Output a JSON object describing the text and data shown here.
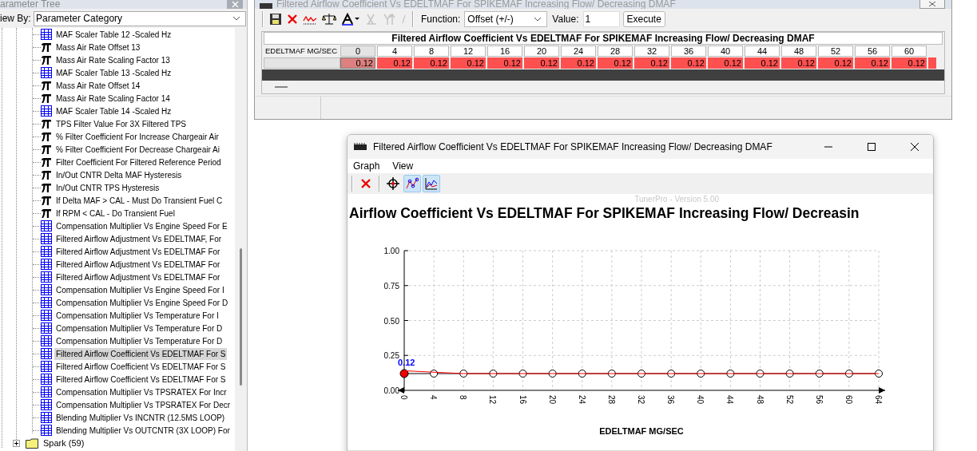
{
  "parameter_tree": {
    "title": "arameter Tree",
    "view_by_label": "iew By:",
    "view_by_value": "Parameter Category",
    "items": [
      {
        "label": "MAF Scaler Table 12 -Scaled Hz",
        "kind": "table",
        "selected": false
      },
      {
        "label": "Mass Air Rate Offset 13",
        "kind": "constant",
        "selected": false
      },
      {
        "label": "Mass Air Rate Scaling Factor 13",
        "kind": "constant",
        "selected": false
      },
      {
        "label": "MAF Scaler Table 13 -Scaled Hz",
        "kind": "table",
        "selected": false
      },
      {
        "label": "Mass Air Rate Offset 14",
        "kind": "constant",
        "selected": false
      },
      {
        "label": "Mass Air Rate Scaling Factor 14",
        "kind": "constant",
        "selected": false
      },
      {
        "label": "MAF Scaler Table 14 -Scaled Hz",
        "kind": "table",
        "selected": false
      },
      {
        "label": "TPS Filter Value For 3X Filtered TPS",
        "kind": "constant",
        "selected": false
      },
      {
        "label": "% Filter Coefficient For Increase Chargeair Air",
        "kind": "constant",
        "selected": false
      },
      {
        "label": "% Filter Coefficient For Decrease Chargeair Ai",
        "kind": "constant",
        "selected": false
      },
      {
        "label": "Filter Coefficient For Filtered Reference Period",
        "kind": "constant",
        "selected": false
      },
      {
        "label": "In/Out CNTR Delta MAF Hysteresis",
        "kind": "constant",
        "selected": false
      },
      {
        "label": "In/Out CNTR TPS Hysteresis",
        "kind": "constant",
        "selected": false
      },
      {
        "label": "If Delta MAF > CAL - Must Do Transient Fuel C",
        "kind": "constant",
        "selected": false
      },
      {
        "label": "If RPM < CAL - Do Transient Fuel",
        "kind": "constant",
        "selected": false
      },
      {
        "label": "Compensation Multiplier Vs Engine Speed For E",
        "kind": "table",
        "selected": false
      },
      {
        "label": "Filtered Airflow Adjustment Vs EDELTMAF, For",
        "kind": "table",
        "selected": false
      },
      {
        "label": "Filtered Airflow Adjustment Vs EDELTMAF For",
        "kind": "table",
        "selected": false
      },
      {
        "label": "Filtered Airflow Adjustment Vs EDELTMAF For",
        "kind": "table",
        "selected": false
      },
      {
        "label": "Filtered Airflow Adjustment Vs EDELTMAF For",
        "kind": "table",
        "selected": false
      },
      {
        "label": "Compensation Multiplier Vs Engine Speed For I",
        "kind": "table",
        "selected": false
      },
      {
        "label": "Compensation Multiplier Vs Engine Speed For D",
        "kind": "table",
        "selected": false
      },
      {
        "label": "Compensation Multiplier Vs Temperature For I",
        "kind": "table",
        "selected": false
      },
      {
        "label": "Compensation Multiplier Vs Temperature For D",
        "kind": "table",
        "selected": false
      },
      {
        "label": "Compensation Multiplier Vs Temperature For D",
        "kind": "table",
        "selected": false
      },
      {
        "label": "Filtered Airflow Coefficient Vs EDELTMAF For S",
        "kind": "table",
        "selected": true
      },
      {
        "label": "Filtered Airflow Coefficient Vs EDELTMAF For S",
        "kind": "table",
        "selected": false
      },
      {
        "label": "Filtered Airflow Coefficient Vs EDELTMAF For S",
        "kind": "table",
        "selected": false
      },
      {
        "label": "Compensation Multiplier Vs TPSRATEX For Incr",
        "kind": "table",
        "selected": false
      },
      {
        "label": "Compensation Multiplier Vs TPSRATEX For Decr",
        "kind": "table",
        "selected": false
      },
      {
        "label": "Blending Multiplier Vs INCNTR (12.5MS LOOP)",
        "kind": "table",
        "selected": false
      },
      {
        "label": "Blending Multiplier Vs OUTCNTR (3X LOOP) For",
        "kind": "table",
        "selected": false
      }
    ],
    "folders": [
      {
        "label": "Spark (59)",
        "expanded": false
      }
    ]
  },
  "table_window": {
    "title": "Filtered Airflow Coefficient Vs EDELTMAF For SPIKEMAF Increasing Flow/ Decreasing DMAF",
    "toolbar": [
      {
        "kind": "save",
        "disabled": false
      },
      {
        "kind": "close",
        "disabled": false
      },
      {
        "kind": "graph",
        "disabled": false
      },
      {
        "kind": "balance",
        "disabled": false
      },
      {
        "kind": "text-style",
        "disabled": false
      },
      {
        "kind": "cut",
        "disabled": true
      },
      {
        "kind": "up",
        "disabled": true
      },
      {
        "kind": "slash",
        "disabled": true
      }
    ],
    "function_label": "Function:",
    "function_value": "Offset (+/-)",
    "value_label": "Value:",
    "value": "1",
    "execute": "Execute",
    "table_title": "Filtered Airflow Coefficient Vs EDELTMAF For SPIKEMAF Increasing Flow/ Decreasing DMAF",
    "row_header": "EDELTMAF MG/SEC",
    "columns": [
      "0",
      "4",
      "8",
      "12",
      "16",
      "20",
      "24",
      "28",
      "32",
      "36",
      "40",
      "44",
      "48",
      "52",
      "56",
      "60"
    ],
    "cells": [
      {
        "value": "0.12",
        "selected": true
      },
      {
        "value": "0.12",
        "selected": false
      },
      {
        "value": "0.12",
        "selected": false
      },
      {
        "value": "0.12",
        "selected": false
      },
      {
        "value": "0.12",
        "selected": false
      },
      {
        "value": "0.12",
        "selected": false
      },
      {
        "value": "0.12",
        "selected": false
      },
      {
        "value": "0.12",
        "selected": false
      },
      {
        "value": "0.12",
        "selected": false
      },
      {
        "value": "0.12",
        "selected": false
      },
      {
        "value": "0.12",
        "selected": false
      },
      {
        "value": "0.12",
        "selected": false
      },
      {
        "value": "0.12",
        "selected": false
      },
      {
        "value": "0.12",
        "selected": false
      },
      {
        "value": "0.12",
        "selected": false
      },
      {
        "value": "0.12",
        "selected": false
      }
    ]
  },
  "graph_window": {
    "title": "Filtered Airflow Coefficient Vs EDELTMAF For SPIKEMAF Increasing Flow/ Decreasing DMAF",
    "menu": [
      "Graph",
      "View"
    ],
    "toolbar": [
      {
        "kind": "close",
        "selected": false
      },
      {
        "kind": "crosshair",
        "selected": false
      },
      {
        "kind": "points",
        "selected": true
      },
      {
        "kind": "lines",
        "selected": true
      }
    ],
    "version": "TunerPro - Version 5.00",
    "chart_data": {
      "type": "line",
      "title": "Airflow Coefficient Vs EDELTMAF For SPIKEMAF Increasing Flow/ Decreasin",
      "xlabel": "EDELTMAF MG/SEC",
      "x": [
        0,
        4,
        8,
        12,
        16,
        20,
        24,
        28,
        32,
        36,
        40,
        44,
        48,
        52,
        56,
        60,
        64
      ],
      "series": [
        {
          "color": "#000000",
          "marker": "circle",
          "values": [
            0.12,
            0.12,
            0.12,
            0.12,
            0.12,
            0.12,
            0.12,
            0.12,
            0.12,
            0.12,
            0.12,
            0.12,
            0.12,
            0.12,
            0.12,
            0.12,
            0.12
          ]
        },
        {
          "color": "#ff0000",
          "values": [
            0.14,
            0.13,
            0.12,
            0.12,
            0.12,
            0.12,
            0.12,
            0.12,
            0.12,
            0.12,
            0.12,
            0.12,
            0.12,
            0.12,
            0.12,
            0.12,
            0.12
          ]
        }
      ],
      "grid": true,
      "xlim": [
        0,
        64
      ],
      "ylim": [
        0,
        1
      ],
      "xticks": [
        0,
        4,
        8,
        12,
        16,
        20,
        24,
        28,
        32,
        36,
        40,
        44,
        48,
        52,
        56,
        60,
        64
      ],
      "yticks": [
        {
          "value": 0,
          "label": "0.00"
        },
        {
          "value": 0.25,
          "label": "0.25"
        },
        {
          "value": 0.5,
          "label": "0.50"
        },
        {
          "value": 0.75,
          "label": "0.75"
        },
        {
          "value": 1,
          "label": "1.00"
        }
      ],
      "annotations": [
        {
          "x": 0,
          "y": 0.12,
          "text": "0.12"
        }
      ]
    }
  }
}
